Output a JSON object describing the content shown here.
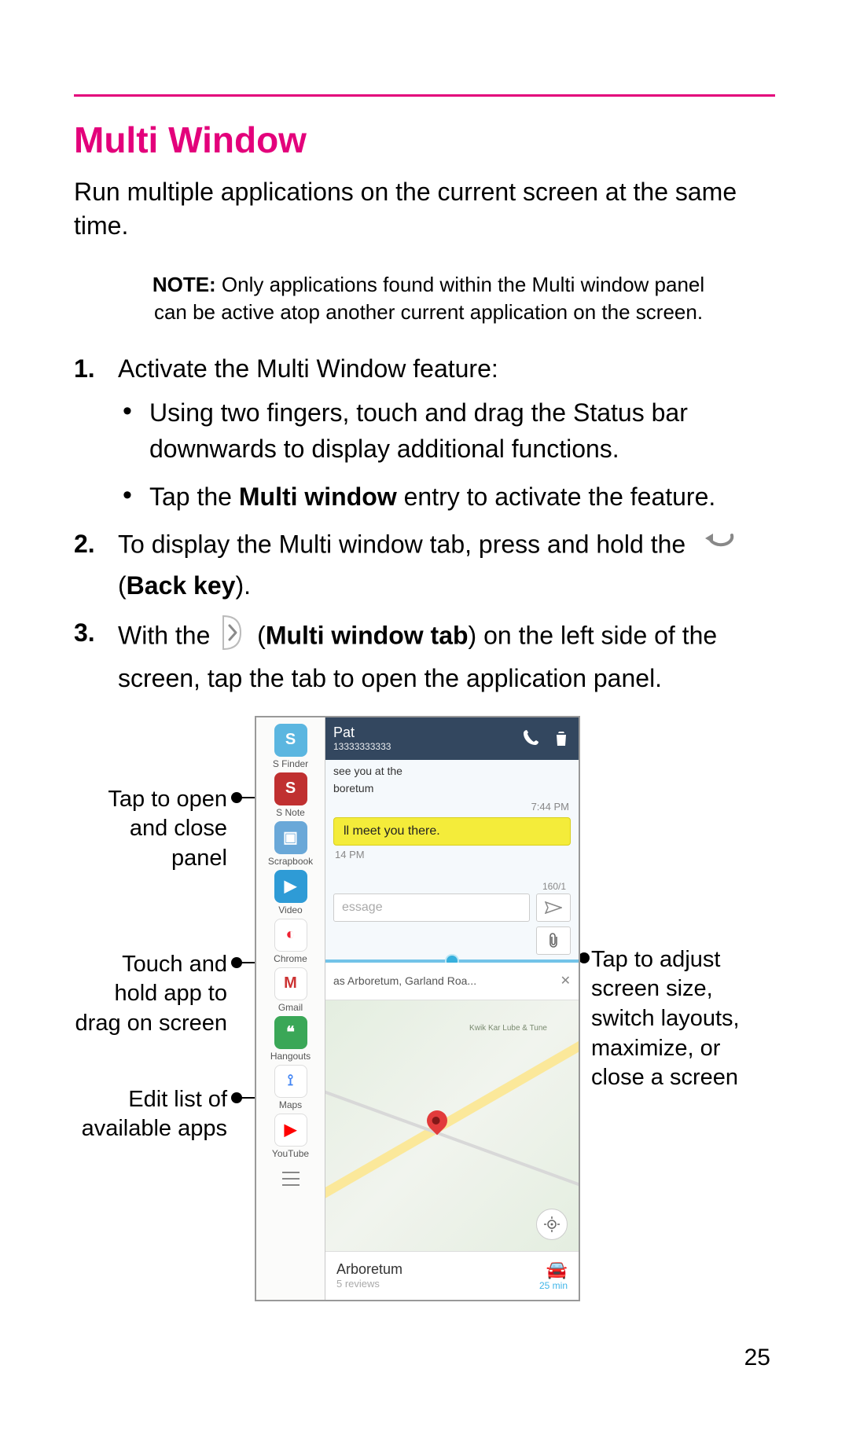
{
  "heading": "Multi Window",
  "intro": "Run multiple applications on the current screen at the same time.",
  "note_label": "NOTE:",
  "note_text": " Only applications found within the Multi window panel can be active atop another current application on the screen.",
  "step1_intro": "Activate the Multi Window feature:",
  "step1_b1": "Using two fingers, touch and drag the Status bar downwards to display additional functions.",
  "step1_b2_a": "Tap the ",
  "step1_b2_bold": "Multi window",
  "step1_b2_b": " entry to activate the feature.",
  "step2_a": "To display the Multi window tab, press and hold the ",
  "step2_b": "(",
  "step2_bold": "Back key",
  "step2_c": ").",
  "step3_a": "With the ",
  "step3_b": "(",
  "step3_bold": "Multi window tab",
  "step3_c": ") on the left side of the screen, tap the tab to open the application panel.",
  "callouts": {
    "c1": "Tap to open and close panel",
    "c2": "Touch and hold app to drag on screen",
    "c3": "Edit list of available apps",
    "c4": "Tap to adjust screen size, switch layouts, maximize, or close a screen"
  },
  "mw_items": [
    "S Finder",
    "S Note",
    "Scrapbook",
    "Video",
    "Chrome",
    "Gmail",
    "Hangouts",
    "Maps",
    "YouTube"
  ],
  "mw_colors": [
    "#5bb6e0",
    "#c03030",
    "#6aa8d8",
    "#2e9bd6",
    "#ffffff",
    "#ffffff",
    "#3aa757",
    "#ffffff",
    "#ffffff"
  ],
  "mw_fg": [
    "S",
    "S",
    "▣",
    "▶",
    "◐",
    "M",
    "❝",
    "⟟",
    "▶"
  ],
  "mw_fgcolor": [
    "#fff",
    "#fff",
    "#fff",
    "#fff",
    "#e23",
    "#c33",
    "#fff",
    "#4285f4",
    "#f00"
  ],
  "top_pane": {
    "name": "Pat",
    "number": "13333333333",
    "line1": "see you at the",
    "line2": "boretum",
    "time_r": "7:44 PM",
    "bubble": "ll meet you there.",
    "time_l": "14 PM",
    "len": "160/1",
    "placeholder": "essage"
  },
  "bottom_pane": {
    "search": "as Arboretum, Garland Roa...",
    "poi": "Kwik Kar Lube & Tune",
    "place": "Arboretum",
    "reviews": "5 reviews",
    "eta": "25 min"
  },
  "page_number": "25"
}
